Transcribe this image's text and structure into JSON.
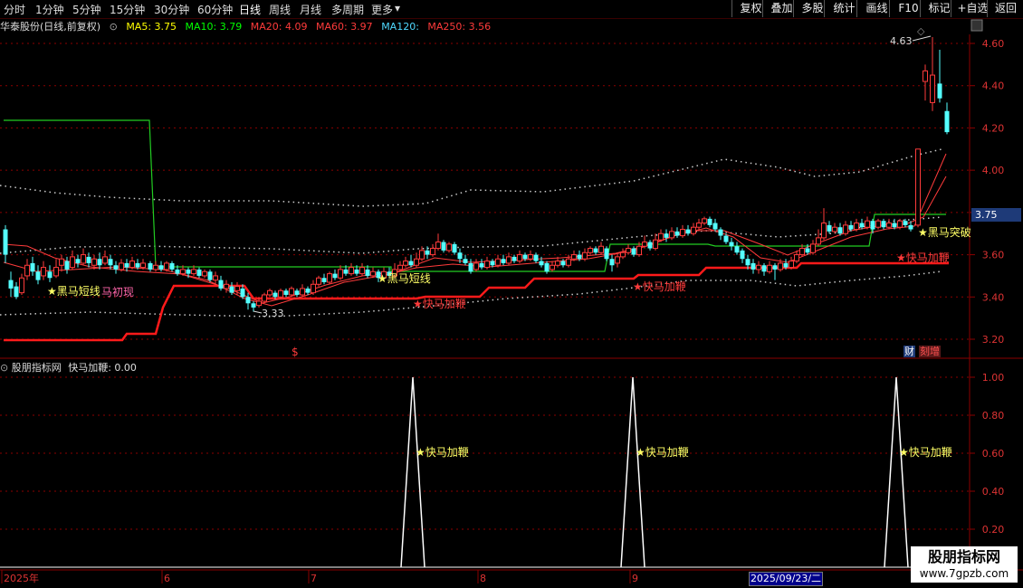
{
  "toolbar": {
    "periods": [
      "分时",
      "1分钟",
      "5分钟",
      "15分钟",
      "30分钟",
      "60分钟",
      "日线",
      "周线",
      "月线",
      "多周期",
      "更多"
    ],
    "active_period": "日线",
    "more_arrow": "▾",
    "right_buttons": [
      "复权",
      "叠加",
      "多股",
      "统计",
      "画线",
      "F10",
      "标记",
      "+自选",
      "返回"
    ]
  },
  "info": {
    "stock": "华泰股份(日线,前复权)",
    "ma5": "MA5: 3.75",
    "ma10": "MA10: 3.79",
    "ma20": "MA20: 4.09",
    "ma60": "MA60: 3.97",
    "ma120": "MA120:",
    "ma250": "MA250: 3.56",
    "colors": {
      "ma5": "#ffff00",
      "ma10": "#00ff00",
      "ma20": "#ff3b3b",
      "ma60": "#ff3b3b",
      "ma120": "#4fd9ff",
      "ma250": "#ff3b3b"
    }
  },
  "price_axis": {
    "ticks": [
      "4.60",
      "4.40",
      "4.20",
      "4.00",
      "3.80",
      "3.60",
      "3.40",
      "3.20"
    ],
    "current_price": "3.75"
  },
  "annotations": {
    "high": "4.63",
    "low": "3.33",
    "signals": [
      "★黑马短线",
      "马初现",
      "★黑马短线",
      "★快马加鞭",
      "★快马加鞭",
      "★快马加鞭",
      "★黑马突破"
    ],
    "dollar": "$",
    "badge_cai": "财",
    "badge_zeng": "刻增"
  },
  "sub": {
    "title": "股朋指标网",
    "indicator": "快马加鞭: 0.00",
    "ticks": [
      "1.00",
      "0.80",
      "0.60",
      "0.40",
      "0.20"
    ],
    "signal_label": "★快马加鞭"
  },
  "date_axis": {
    "labels": [
      "2025年",
      "6",
      "7",
      "8",
      "9"
    ],
    "cursor_date": "2025/09/23/二"
  },
  "watermark": {
    "title": "股朋指标网",
    "url": "www.7gpzb.com"
  },
  "chart_data": {
    "type": "candlestick",
    "price_range": [
      3.15,
      4.68
    ],
    "volume_indicator": {
      "name": "快马加鞭",
      "range": [
        0,
        1.05
      ],
      "spikes": [
        1,
        1,
        1
      ]
    }
  }
}
